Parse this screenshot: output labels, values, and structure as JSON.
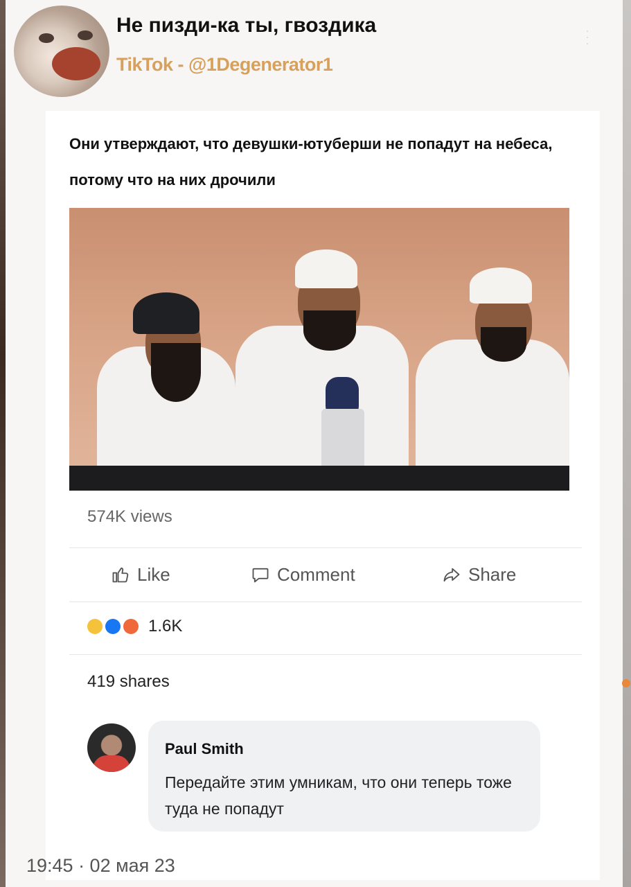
{
  "header": {
    "title": "Не пизди-ка ты, гвоздика",
    "subtitle": "TikTok - @1Degenerator1"
  },
  "post": {
    "text": "Они утверждают, что девушки-ютуберши не попадут на небеса, потому что на них дрочили",
    "views": "574K views",
    "actions": {
      "like": "Like",
      "comment": "Comment",
      "share": "Share"
    },
    "reactions": {
      "icons": [
        "laugh-reaction-icon",
        "like-reaction-icon",
        "angry-reaction-icon"
      ],
      "count": "1.6K"
    },
    "shares": "419 shares",
    "comment": {
      "author": "Paul Smith",
      "text": "Передайте этим умникам, что они теперь тоже туда не попадут"
    }
  },
  "footer": {
    "timestamp": "19:45 · 02 мая 23"
  },
  "colors": {
    "tiktok_handle": "#d7a05b",
    "card_bg": "#f7f6f5",
    "accent_dot": "#e9873b"
  }
}
